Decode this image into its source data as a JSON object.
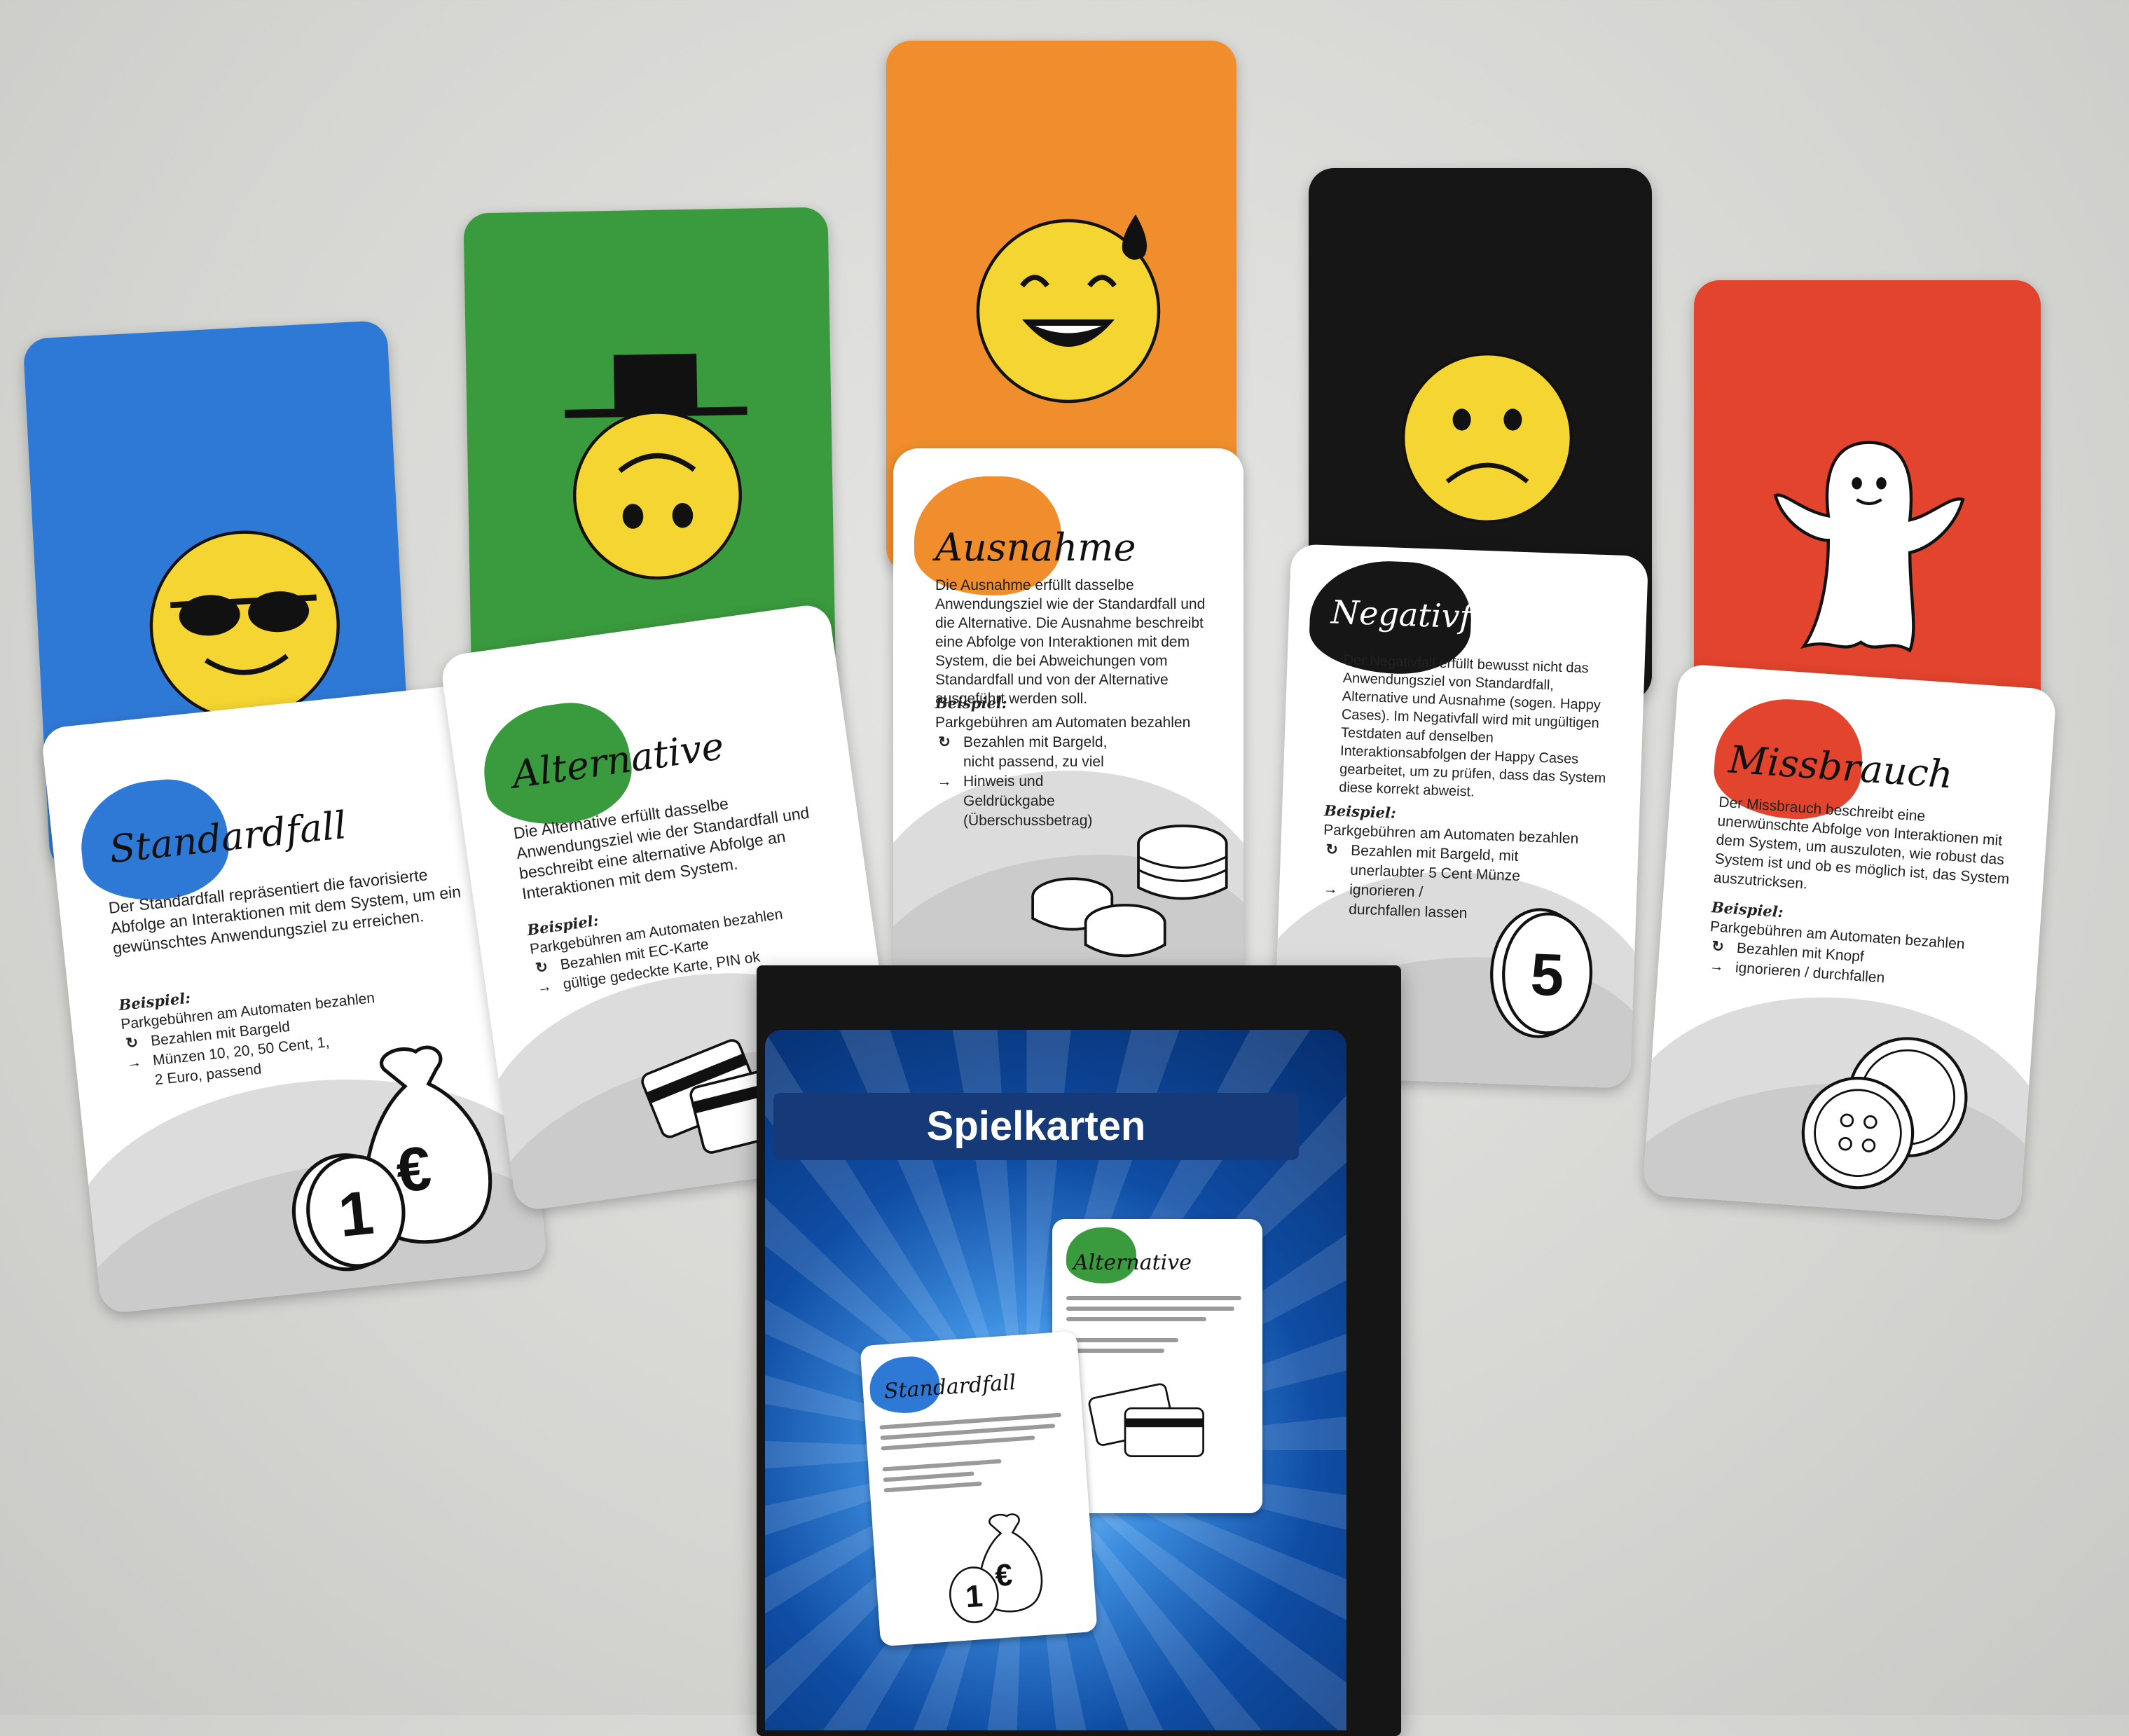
{
  "colors": {
    "blue": "#2f79d6",
    "green": "#3a9a3e",
    "orange": "#f08e2d",
    "black": "#161616",
    "red": "#e2442e",
    "emoji_yellow": "#f5d531"
  },
  "cards": [
    {
      "id": "standardfall",
      "icon": "sunglasses-smiley-icon",
      "title": "Standardfall",
      "description": "Der Standardfall repräsentiert die favorisierte Abfolge an Interaktionen mit dem System, um ein gewünschtes Anwendungsziel zu erreichen.",
      "example_label": "Beispiel:",
      "example_goal": "Parkgebühren am Automaten bezahlen",
      "input": "Bezahlen mit Bargeld",
      "output": "Münzen 10, 20, 50 Cent, 1, 2 Euro, passend",
      "illustration": "money-bag-and-coin"
    },
    {
      "id": "alternative",
      "icon": "top-hat-upside-down-smiley-icon",
      "title": "Alternative",
      "description": "Die Alternative erfüllt dasselbe Anwendungsziel wie der Standardfall und beschreibt eine alternative Abfolge an Interaktionen mit dem System.",
      "example_label": "Beispiel:",
      "example_goal": "Parkgebühren am Automaten bezahlen",
      "input": "Bezahlen mit EC-Karte",
      "output": "gültige gedeckte Karte, PIN ok",
      "illustration": "bank-cards"
    },
    {
      "id": "ausnahme",
      "icon": "sweat-smile-smiley-icon",
      "title": "Ausnahme",
      "description": "Die Ausnahme erfüllt dasselbe Anwendungsziel wie der Standardfall und die Alternative. Die Ausnahme beschreibt eine Abfolge von Interaktionen mit dem System, die bei Abweichungen vom Standardfall und von der Alternative ausgeführt werden soll.",
      "example_label": "Beispiel:",
      "example_goal": "Parkgebühren am Automaten bezahlen",
      "input": "Bezahlen mit Bargeld, nicht passend, zu viel",
      "output": "Hinweis und Geldrückgabe (Überschussbetrag)",
      "illustration": "coin-stacks"
    },
    {
      "id": "negativfall",
      "icon": "sad-smiley-icon",
      "title": "Negativfall",
      "description": "Der Negativfall erfüllt bewusst nicht das Anwendungsziel von Standardfall, Alternative und Ausnahme (sogen. Happy Cases). Im Negativfall wird mit ungültigen Testdaten auf denselben Interaktionsabfolgen der Happy Cases gearbeitet, um zu prüfen, dass das System diese korrekt abweist.",
      "example_label": "Beispiel:",
      "example_goal": "Parkgebühren am Automaten bezahlen",
      "input": "Bezahlen mit Bargeld, mit unerlaubter 5 Cent Münze",
      "output": "ignorieren / durchfallen lassen",
      "illustration": "five-cent-coin",
      "coin_value": "5"
    },
    {
      "id": "missbrauch",
      "icon": "ghost-icon",
      "title": "Missbrauch",
      "description": "Der Missbrauch beschreibt eine unerwünschte Abfolge von Interaktionen mit dem System, um auszuloten, wie robust das System ist und ob es möglich ist, das System auszutricksen.",
      "example_label": "Beispiel:",
      "example_goal": "Parkgebühren am Automaten bezahlen",
      "input": "Bezahlen mit Knopf",
      "output": "ignorieren / durchfallen",
      "illustration": "buttons"
    }
  ],
  "box": {
    "title": "Spielkarten",
    "mini_cards": [
      "Standardfall",
      "Alternative"
    ]
  },
  "coin_marks": {
    "euro": "€",
    "one": "1"
  }
}
